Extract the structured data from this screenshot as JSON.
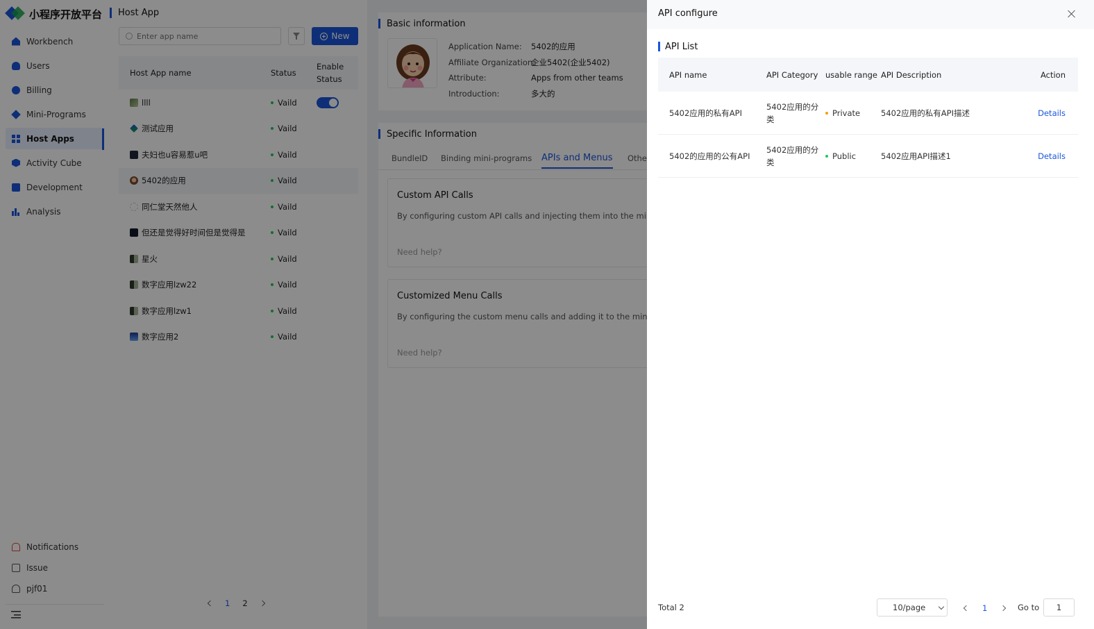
{
  "brand": {
    "name": "小程序开放平台"
  },
  "sidebar": {
    "items": [
      {
        "label": "Workbench",
        "icon": "home-icon"
      },
      {
        "label": "Users",
        "icon": "user-icon"
      },
      {
        "label": "Billing",
        "icon": "billing-icon"
      },
      {
        "label": "Mini-Programs",
        "icon": "diamond-icon"
      },
      {
        "label": "Host Apps",
        "icon": "grid-icon",
        "active": true
      },
      {
        "label": "Activity Cube",
        "icon": "cube-icon"
      },
      {
        "label": "Development",
        "icon": "terminal-icon"
      },
      {
        "label": "Analysis",
        "icon": "bar-chart-icon"
      }
    ],
    "bottom": [
      {
        "label": "Notifications",
        "icon": "bell-icon"
      },
      {
        "label": "Issue",
        "icon": "clipboard-icon"
      },
      {
        "label": "pjf01",
        "icon": "person-icon"
      }
    ]
  },
  "host_app": {
    "title": "Host App",
    "search_placeholder": "Enter app name",
    "new_label": "New",
    "columns": {
      "name": "Host App name",
      "status": "Status",
      "enable": "Enable Status"
    },
    "rows": [
      {
        "name": "llll",
        "status": "Vaild"
      },
      {
        "name": "测试应用",
        "status": "Vaild"
      },
      {
        "name": "夫妇也u容易惹u吧",
        "status": "Vaild"
      },
      {
        "name": "5402的应用",
        "status": "Vaild"
      },
      {
        "name": "同仁堂天然他人",
        "status": "Vaild"
      },
      {
        "name": "但还是觉得好时间但是觉得是",
        "status": "Vaild"
      },
      {
        "name": "星火",
        "status": "Vaild"
      },
      {
        "name": "数字应用lzw22",
        "status": "Vaild"
      },
      {
        "name": "数字应用lzw1",
        "status": "Vaild"
      },
      {
        "name": "数字应用2",
        "status": "Vaild"
      }
    ],
    "pagination": {
      "pages": [
        "1",
        "2"
      ],
      "current": "1"
    }
  },
  "basic": {
    "title": "Basic information",
    "fields": [
      {
        "label": "Application Name:",
        "value": "5402的应用"
      },
      {
        "label": "Affiliate Organization:",
        "value": "企业5402(企业5402)"
      },
      {
        "label": "Attribute:",
        "value": "Apps from other teams"
      },
      {
        "label": "Introduction:",
        "value": "多大的"
      }
    ]
  },
  "specific": {
    "title": "Specific Information",
    "tabs": [
      "BundleID",
      "Binding mini-programs",
      "APIs and Menus",
      "Other"
    ],
    "active_tab": "APIs and Menus",
    "cards": [
      {
        "title": "Custom API Calls",
        "desc": "By configuring custom API calls and injecting them into the mini-prog",
        "help": "Need help?"
      },
      {
        "title": "Customized Menu Calls",
        "desc": "By configuring the custom menu calls and adding it to the mini-progr",
        "help": "Need help?"
      }
    ]
  },
  "drawer": {
    "title": "API configure",
    "list_title": "API List",
    "columns": {
      "name": "API name",
      "category": "API Category",
      "range": "usable range",
      "desc": "API Description",
      "action": "Action"
    },
    "rows": [
      {
        "name": "5402应用的私有API",
        "category": "5402应用的分类",
        "range": "Private",
        "range_color": "#f59e0b",
        "desc": "5402应用的私有API描述",
        "action": "Details"
      },
      {
        "name": "5402的应用的公有API",
        "category": "5402应用的分类",
        "range": "Public",
        "range_color": "#22c55e",
        "desc": "5402应用API描述1",
        "action": "Details"
      }
    ],
    "footer": {
      "total": "Total 2",
      "page_size": "10/page",
      "current_page": "1",
      "goto_label": "Go to",
      "goto_value": "1"
    }
  },
  "colors": {
    "accent": "#1a56db",
    "valid": "#22c55e",
    "private": "#f59e0b"
  }
}
